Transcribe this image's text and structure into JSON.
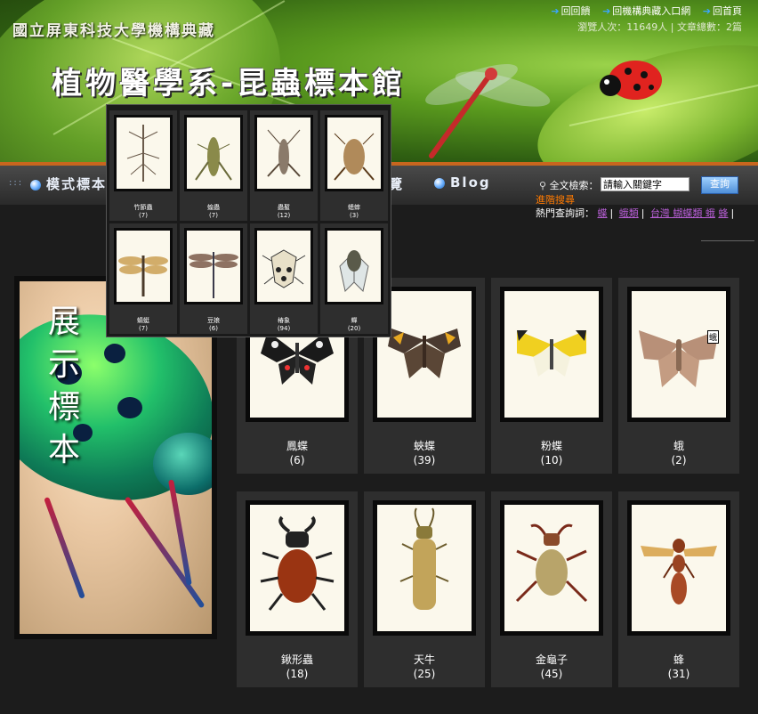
{
  "header": {
    "site_name": "國立屏東科技大學機構典藏",
    "title": "植物醫學系-昆蟲標本館",
    "links": [
      "回首頁",
      "回機構典藏入口網",
      "回回饋"
    ],
    "stats_visitors_label": "瀏覽人次：",
    "stats_visitors": "11649人",
    "stats_articles_label": "文章總數：",
    "stats_articles": "2篇"
  },
  "nav": {
    "items": [
      "模式標本",
      "瀏覽",
      "Blog"
    ],
    "search_label": "全文檢索：",
    "search_placeholder": "請輸入關鍵字",
    "search_button": "查詢",
    "advanced": "進階搜尋",
    "hot_label": "熱門查詢詞：",
    "hot_keywords": [
      "蝶",
      "蛾類",
      "台灣 蝴蝶類 蛾",
      "蜂"
    ]
  },
  "showcase": {
    "label": "展示標本"
  },
  "specimens": [
    {
      "name": "鳳蝶",
      "count": "(6)"
    },
    {
      "name": "蛺蝶",
      "count": "(39)"
    },
    {
      "name": "粉蝶",
      "count": "(10)"
    },
    {
      "name": "蛾",
      "count": "(2)",
      "tag": "蛾"
    },
    {
      "name": "鍬形蟲",
      "count": "(18)"
    },
    {
      "name": "天牛",
      "count": "(25)"
    },
    {
      "name": "金龜子",
      "count": "(45)"
    },
    {
      "name": "蜂",
      "count": "(31)"
    }
  ],
  "popup": [
    {
      "name": "竹節蟲",
      "count": "(7)"
    },
    {
      "name": "蝗蟲",
      "count": "(7)"
    },
    {
      "name": "蟲蟴",
      "count": "(12)"
    },
    {
      "name": "蟋蟀",
      "count": "(3)"
    },
    {
      "name": "蜻蜓",
      "count": "(7)"
    },
    {
      "name": "豆娘",
      "count": "(6)"
    },
    {
      "name": "椿象",
      "count": "(94)"
    },
    {
      "name": "蟬",
      "count": "(20)"
    }
  ],
  "colors": {
    "accent_orange": "#c8661e",
    "link_purple": "#b85fd6",
    "nav_blue": "#3aa6ff"
  }
}
